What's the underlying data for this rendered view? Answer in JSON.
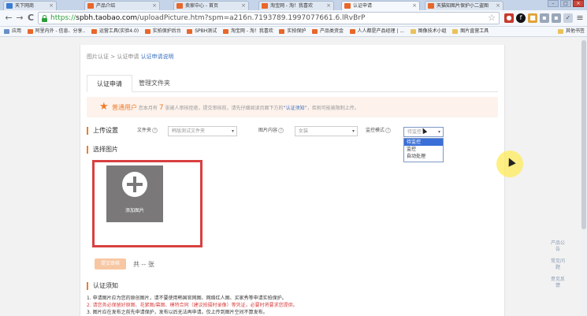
{
  "browser": {
    "tabs": [
      {
        "label": "天下网商",
        "active": false
      },
      {
        "label": "产品介绍",
        "active": false
      },
      {
        "label": "卖家中心 - 首页",
        "active": false
      },
      {
        "label": "淘宝网 - 淘！我喜欢",
        "active": false
      },
      {
        "label": "认证申请",
        "active": true
      },
      {
        "label": "天猫知图片保护小二盗图",
        "active": false
      }
    ],
    "window_buttons": {
      "minimize": "–",
      "maximize": "□",
      "close": "×"
    },
    "nav": {
      "back": "←",
      "forward": "→",
      "reload": "C"
    },
    "url": {
      "scheme": "https://",
      "host": "spbh.taobao.com",
      "path": "/uploadPicture.htm?spm=a216n.7193789.1997077661.6.lRvBrP"
    },
    "bookmarks": [
      {
        "label": "应用",
        "icon": "grid"
      },
      {
        "label": "阿里内外 - 信息、分享..",
        "icon": "site"
      },
      {
        "label": "运营工具(实验4.0)",
        "icon": "site"
      },
      {
        "label": "实拍保护后台",
        "icon": "site"
      },
      {
        "label": "SPBH测试",
        "icon": "site"
      },
      {
        "label": "淘宝网 - 淘！我喜欢",
        "icon": "site"
      },
      {
        "label": "实拍保护",
        "icon": "site"
      },
      {
        "label": "产品类资金",
        "icon": "site"
      },
      {
        "label": "人人都是产品经理 | ...",
        "icon": "site"
      },
      {
        "label": "图像技术小组",
        "icon": "folder"
      },
      {
        "label": "图片直营工具",
        "icon": "folder"
      }
    ],
    "other_bookmarks": "其他书签"
  },
  "page": {
    "breadcrumb": {
      "part1": "图片认证",
      "sep": " > ",
      "part2": "认证申请",
      "current": "认证申请说明"
    },
    "tabs": [
      "认证申请",
      "管理文件夹"
    ],
    "notice": {
      "role": "普通用户",
      "pre": "您本月有",
      "count": "7",
      "post": "张被人审核拒绝，提交审核前，请先仔细阅读页面下方的",
      "link": "“认证须知”",
      "tail": "，否则可能被限制上传。"
    },
    "upload_settings": {
      "title": "上传设置",
      "folder_label": "文件夹",
      "folder_value": "韩版测试文件夹",
      "content_label": "图片内容",
      "content_value": "女装",
      "monitor_label": "监控模式",
      "monitor_value": "待监控",
      "monitor_options": [
        "待监控",
        "监控",
        "自动处理"
      ]
    },
    "select_images": {
      "title": "选择图片",
      "add_label": "添加图片"
    },
    "submit_label": "提交审核",
    "count_text": "共 -- 张",
    "rules": {
      "title": "认证须知",
      "items": [
        {
          "text": "1. 申请图片应为您的原创图片，请不要使用韩国官网图、网络红人图、买家秀等申请实拍保护。",
          "highlight": false
        },
        {
          "text": "2. 请您务必保留好原图、花絮图/幕图、模特合同（建议拍摄时录像）等凭证，必要时将要求您提供。",
          "highlight": true
        },
        {
          "text": "3. 图片应在发布之前先申请保护，发布以后无法再申请。仅上传到图片空间不算发布。",
          "highlight": false
        }
      ]
    },
    "side_float": [
      "产品公告",
      "常见问题",
      "意见反馈"
    ]
  }
}
